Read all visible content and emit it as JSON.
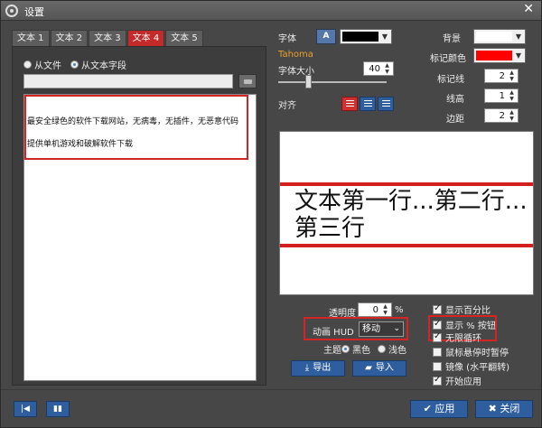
{
  "window": {
    "title": "设置",
    "close_glyph": "✕"
  },
  "tabs": [
    {
      "label": "文本 1"
    },
    {
      "label": "文本 2"
    },
    {
      "label": "文本 3"
    },
    {
      "label": "文本 4",
      "active": true
    },
    {
      "label": "文本 5"
    }
  ],
  "source": {
    "option_file": "从文件",
    "option_field": "从文本字段",
    "selected": "从文本字段",
    "file_path": ""
  },
  "text_content": {
    "line1": "最安全绿色的软件下载网站，无病毒，无插件，无恶意代码",
    "line2": "提供单机游戏和破解软件下载"
  },
  "font": {
    "label": "字体",
    "button_glyph": "A",
    "color": "#000000",
    "name": "Tahoma",
    "size_label": "字体大小",
    "size_value": "40",
    "size_slider_fraction": 0.27,
    "align_label": "对齐",
    "align_selected": "left"
  },
  "appearance": {
    "background_label": "背景",
    "background_color": "#ffffff",
    "mark_color_label": "标记颜色",
    "mark_color": "#ff0000",
    "mark_line_label": "标记线",
    "mark_line_value": "2",
    "line_height_label": "线高",
    "line_height_value": "1",
    "margin_label": "边距",
    "margin_value": "2"
  },
  "preview": {
    "text": "文本第一行...第二行...第三行"
  },
  "transparency": {
    "label": "透明度",
    "value": "0",
    "unit": "%"
  },
  "animation": {
    "label": "动画 HUD",
    "value": "移动"
  },
  "theme": {
    "label": "主题",
    "dark": "黑色",
    "light": "浅色",
    "selected": "黑色"
  },
  "buttons": {
    "export": "导出",
    "import": "导入",
    "apply": "应用",
    "close": "关闭"
  },
  "options": [
    {
      "label": "显示百分比",
      "checked": true
    },
    {
      "label": "显示 % 按钮",
      "checked": true
    },
    {
      "label": "无限循环",
      "checked": true
    },
    {
      "label": "鼠标悬停时暂停",
      "checked": false
    },
    {
      "label": "镜像 (水平翻转)",
      "checked": false
    },
    {
      "label": "开始应用",
      "checked": true
    }
  ],
  "icons": {
    "app": "gear-icon",
    "first": "skip-back-icon",
    "pause": "pause-icon",
    "export": "download-icon",
    "import": "folder-open-icon",
    "apply": "check-icon",
    "close": "close-icon"
  }
}
